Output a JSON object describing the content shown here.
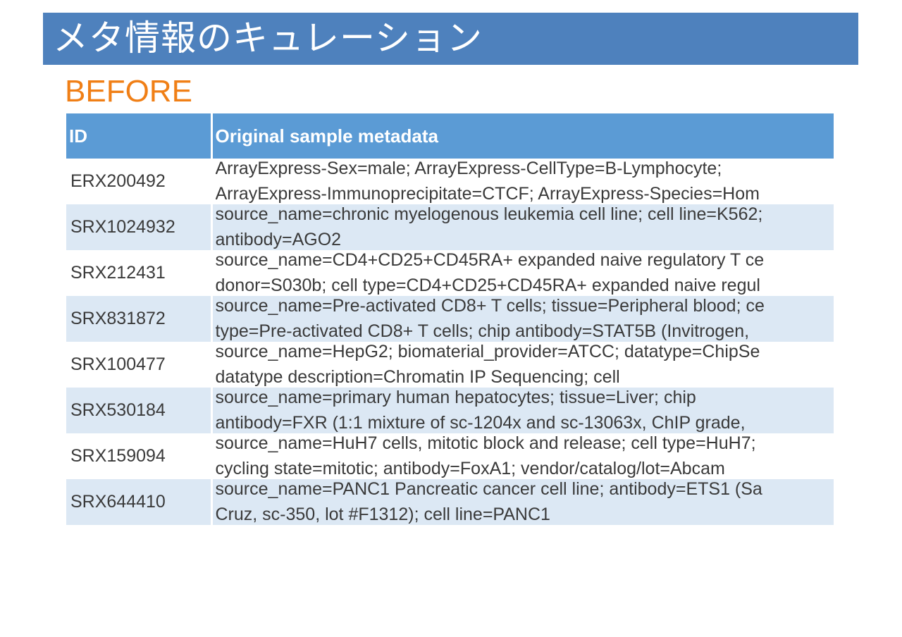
{
  "slide": {
    "title": "メタ情報のキュレーション",
    "subtitle": "BEFORE"
  },
  "colors": {
    "title_bar": "#4e81bd",
    "subtitle": "#f07f16",
    "table_header": "#5b9bd5",
    "row_alt": "#dce8f4"
  },
  "table": {
    "headers": [
      "ID",
      "Original sample metadata"
    ],
    "rows": [
      {
        "id": "ERX200492",
        "lines": [
          "ArrayExpress-Sex=male; ArrayExpress-CellType=B-Lymphocyte;",
          "ArrayExpress-Immunoprecipitate=CTCF; ArrayExpress-Species=Hom"
        ]
      },
      {
        "id": "SRX1024932",
        "lines": [
          "source_name=chronic myelogenous leukemia cell line; cell line=K562;",
          "antibody=AGO2"
        ]
      },
      {
        "id": "SRX212431",
        "lines": [
          "source_name=CD4+CD25+CD45RA+ expanded naive regulatory T ce",
          "donor=S030b; cell type=CD4+CD25+CD45RA+ expanded naive regul"
        ]
      },
      {
        "id": "SRX831872",
        "lines": [
          "source_name=Pre-activated CD8+ T cells; tissue=Peripheral blood; ce",
          "type=Pre-activated CD8+ T cells; chip antibody=STAT5B (Invitrogen,"
        ]
      },
      {
        "id": "SRX100477",
        "lines": [
          "source_name=HepG2; biomaterial_provider=ATCC; datatype=ChipSe",
          "datatype description=Chromatin IP Sequencing; cell"
        ]
      },
      {
        "id": "SRX530184",
        "lines": [
          "source_name=primary human hepatocytes; tissue=Liver; chip",
          "antibody=FXR (1:1 mixture of sc-1204x and sc-13063x, ChIP grade,"
        ]
      },
      {
        "id": "SRX159094",
        "lines": [
          "source_name=HuH7 cells, mitotic block and release; cell type=HuH7;",
          "cycling state=mitotic; antibody=FoxA1; vendor/catalog/lot=Abcam"
        ]
      },
      {
        "id": "SRX644410",
        "lines": [
          "source_name=PANC1 Pancreatic cancer cell line; antibody=ETS1 (Sa",
          "Cruz, sc-350, lot #F1312); cell line=PANC1"
        ]
      }
    ]
  }
}
